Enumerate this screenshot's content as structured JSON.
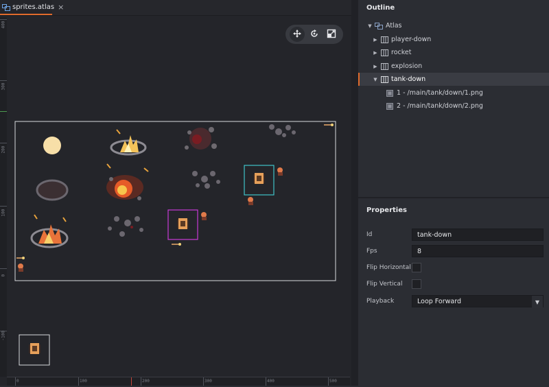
{
  "editor": {
    "tab_title": "sprites.atlas",
    "close_glyph": "×",
    "ruler_h": [
      "0",
      "100",
      "200",
      "300",
      "400",
      "500"
    ],
    "ruler_v": [
      "400",
      "300",
      "200",
      "100",
      "0",
      "-100"
    ]
  },
  "toolbar": {
    "tools": [
      {
        "icon": "move-icon",
        "active": true
      },
      {
        "icon": "rotate-icon",
        "active": false
      },
      {
        "icon": "scale-icon",
        "active": false
      }
    ]
  },
  "outline": {
    "title": "Outline",
    "items": [
      {
        "label": "Atlas",
        "depth": 0,
        "arrow": "▼",
        "icon": "atlas-icon"
      },
      {
        "label": "player-down",
        "depth": 1,
        "arrow": "▶",
        "icon": "animation-icon"
      },
      {
        "label": "rocket",
        "depth": 1,
        "arrow": "▶",
        "icon": "animation-icon"
      },
      {
        "label": "explosion",
        "depth": 1,
        "arrow": "▶",
        "icon": "animation-icon"
      },
      {
        "label": "tank-down",
        "depth": 1,
        "arrow": "▼",
        "icon": "animation-icon",
        "selected": true
      },
      {
        "label": "1 - /main/tank/down/1.png",
        "depth": 2,
        "arrow": "",
        "icon": "image-icon"
      },
      {
        "label": "2 - /main/tank/down/2.png",
        "depth": 2,
        "arrow": "",
        "icon": "image-icon"
      }
    ]
  },
  "properties": {
    "title": "Properties",
    "id_label": "Id",
    "id_value": "tank-down",
    "fps_label": "Fps",
    "fps_value": "8",
    "flip_h_label": "Flip Horizontal",
    "flip_h_checked": false,
    "flip_v_label": "Flip Vertical",
    "flip_v_checked": false,
    "playback_label": "Playback",
    "playback_value": "Loop Forward",
    "playback_arrow": "▼"
  },
  "colors": {
    "accent": "#e06b2c",
    "selection_cyan": "#3fc3c9",
    "selection_magenta": "#c73ad6",
    "canvas_bg": "#24252a",
    "panel_bg": "#2b2d33"
  }
}
